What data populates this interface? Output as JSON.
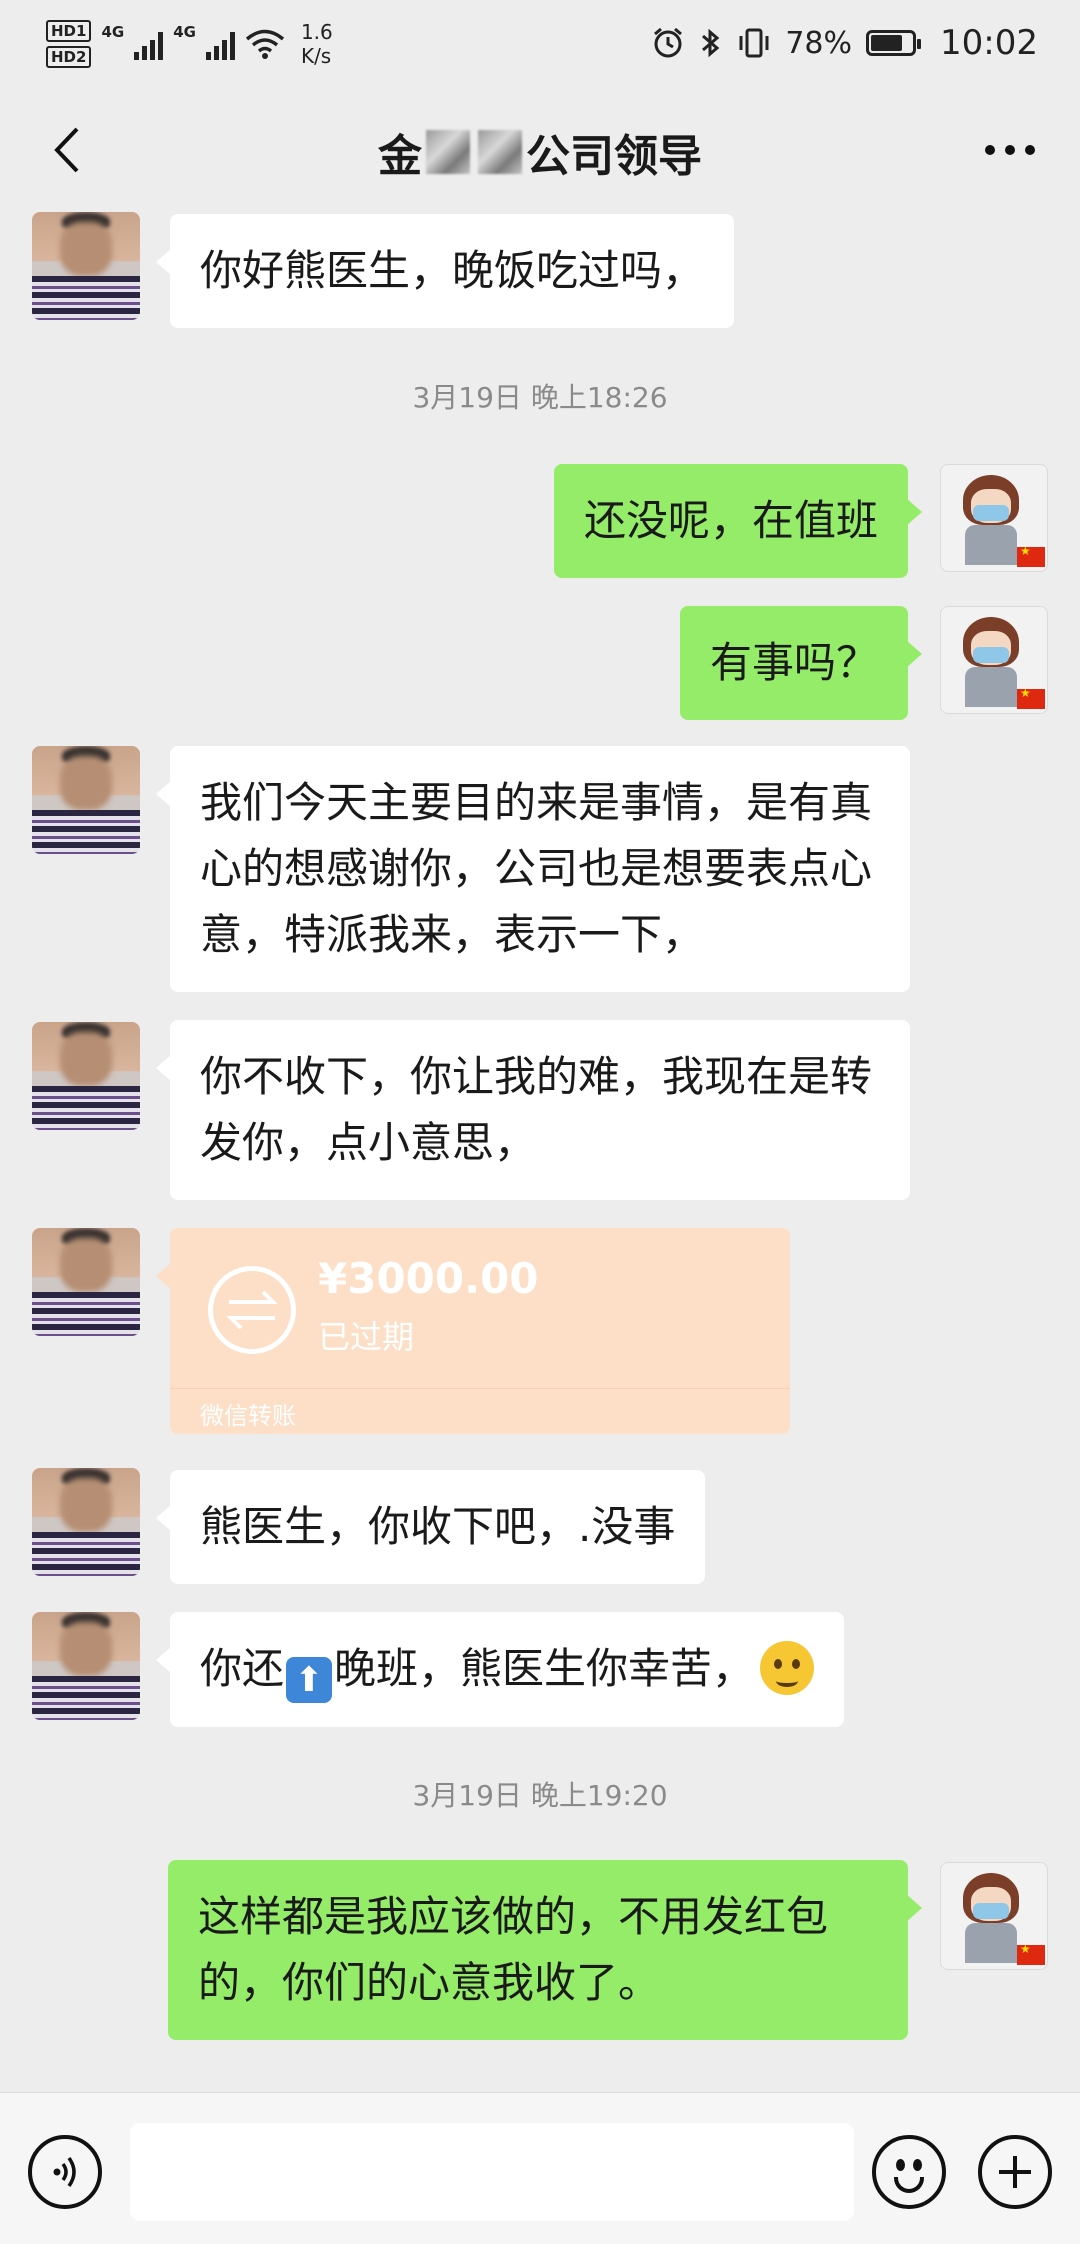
{
  "status_bar": {
    "hd1": "HD1",
    "hd2": "HD2",
    "net1": "4G",
    "net2": "4G",
    "speed_value": "1.6",
    "speed_unit": "K/s",
    "battery": "78%",
    "time": "10:02",
    "icons": [
      "alarm-icon",
      "bluetooth-icon",
      "vibrate-icon",
      "battery-icon",
      "wifi-icon",
      "signal-icon"
    ]
  },
  "header": {
    "title_prefix": "金",
    "title_suffix": "公司领导",
    "back_icon": "chevron-left-icon",
    "more_icon": "more-dots-icon"
  },
  "messages": {
    "m1": "你好熊医生，晚饭吃过吗，",
    "ts1": "3月19日 晚上18:26",
    "m2": "还没呢，在值班",
    "m3": "有事吗？",
    "m4": "我们今天主要目的来是事情，是有真心的想感谢你，公司也是想要表点心意，特派我来，表示一下，",
    "m5": "你不收下，你让我的难，我现在是转发你，点小意思，",
    "transfer_amount": "¥3000.00",
    "transfer_status": "已过期",
    "transfer_footer": "微信转账",
    "m6": "熊医生，你收下吧，.没事",
    "m7_before": "你还",
    "m7_after": "晚班，熊医生你幸苦，",
    "ts2": "3月19日 晚上19:20",
    "m8": "这样都是我应该做的，不用发红包的，你们的心意我收了。"
  },
  "input_bar": {
    "placeholder": "",
    "voice_icon": "voice-icon",
    "emoji_icon": "emoji-icon",
    "plus_icon": "plus-icon"
  },
  "colors": {
    "background": "#ededed",
    "my_bubble": "#95ec69",
    "their_bubble": "#ffffff",
    "transfer_expired": "#fcdfc6"
  }
}
